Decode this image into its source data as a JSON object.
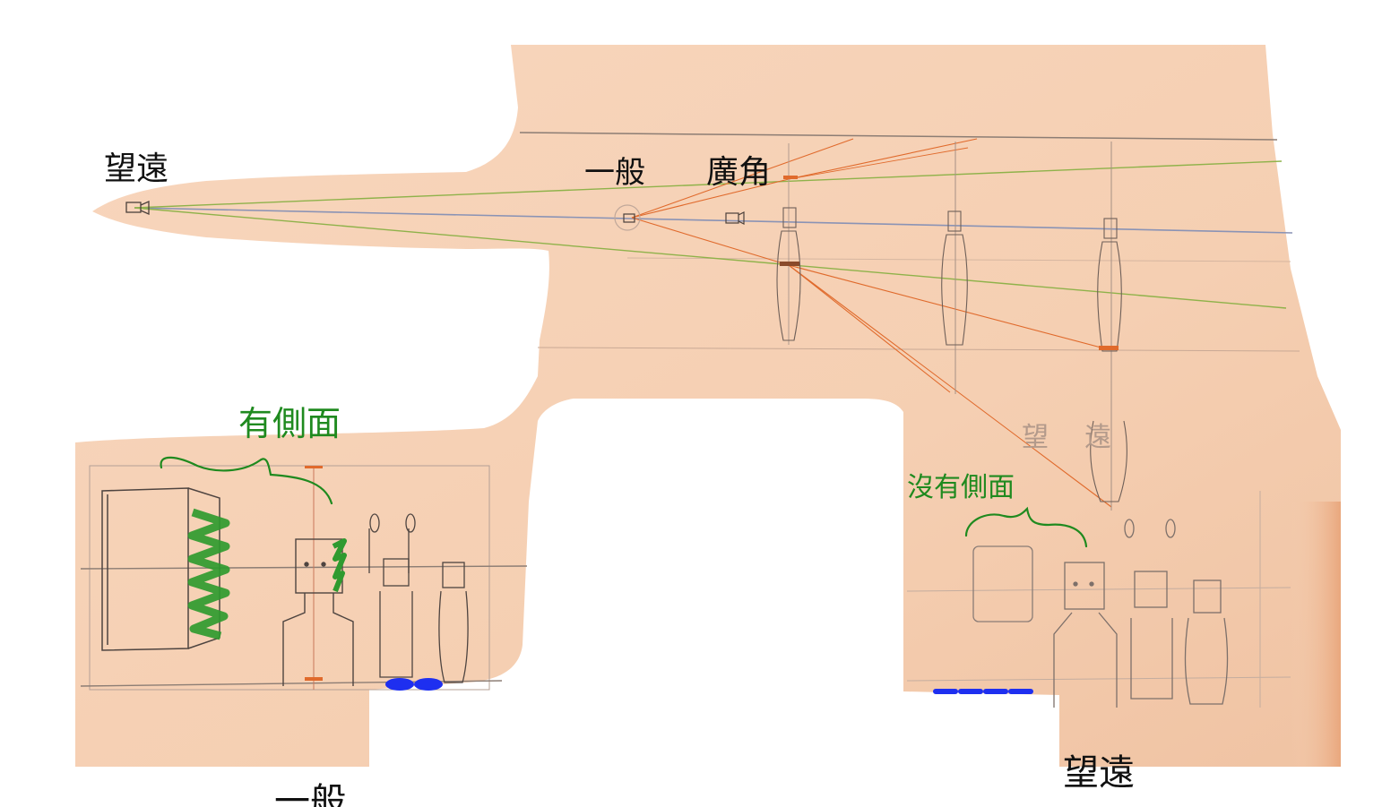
{
  "labels": {
    "telephoto_top": "望遠",
    "normal_top": "一般",
    "wide_top": "廣角",
    "has_side": "有側面",
    "no_side": "沒有側面",
    "telephoto_bottom_right": "望遠",
    "normal_bottom_left": "一般",
    "telephoto_pencil_note": "望遠"
  },
  "colors": {
    "paper": "#f6d2b6",
    "paper_shade": "#efc2a4",
    "pencil": "#6e5f58",
    "orange_line": "#e06a2c",
    "green_line": "#8fb24a",
    "blue_line": "#8a93b5",
    "green_marker": "#2f9a2f",
    "blue_marker": "#1e2ff0",
    "ink": "#111111"
  }
}
